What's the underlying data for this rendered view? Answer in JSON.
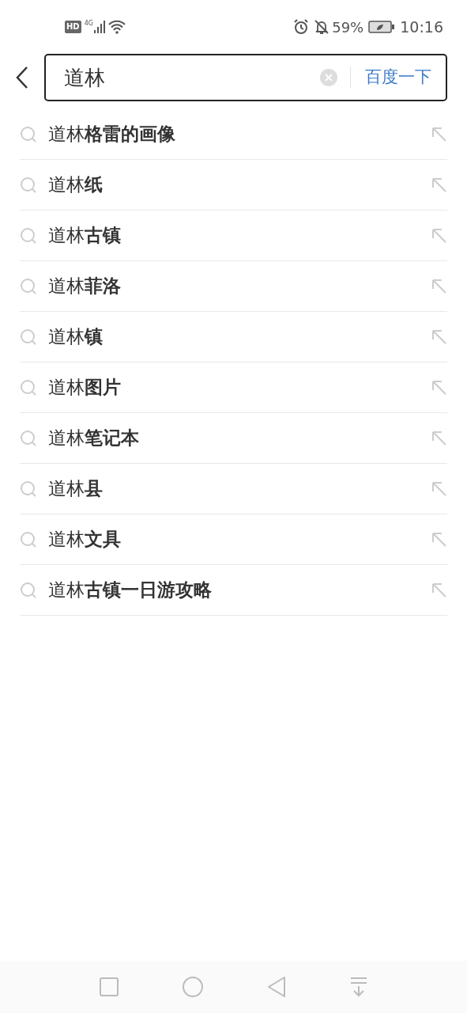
{
  "status_bar": {
    "hd": "HD",
    "network": "4G",
    "battery": "59%",
    "time": "10:16"
  },
  "search": {
    "value": "道林",
    "button": "百度一下"
  },
  "suggestions": [
    "道林**格雷的画像**",
    "道林**纸**",
    "道林**古镇**",
    "道林**菲洛**",
    "道林**镇**",
    "道林**图片**",
    "道林**笔记本**",
    "道林**县**",
    "道林**文具**",
    "道林**古镇一日游攻略**"
  ]
}
